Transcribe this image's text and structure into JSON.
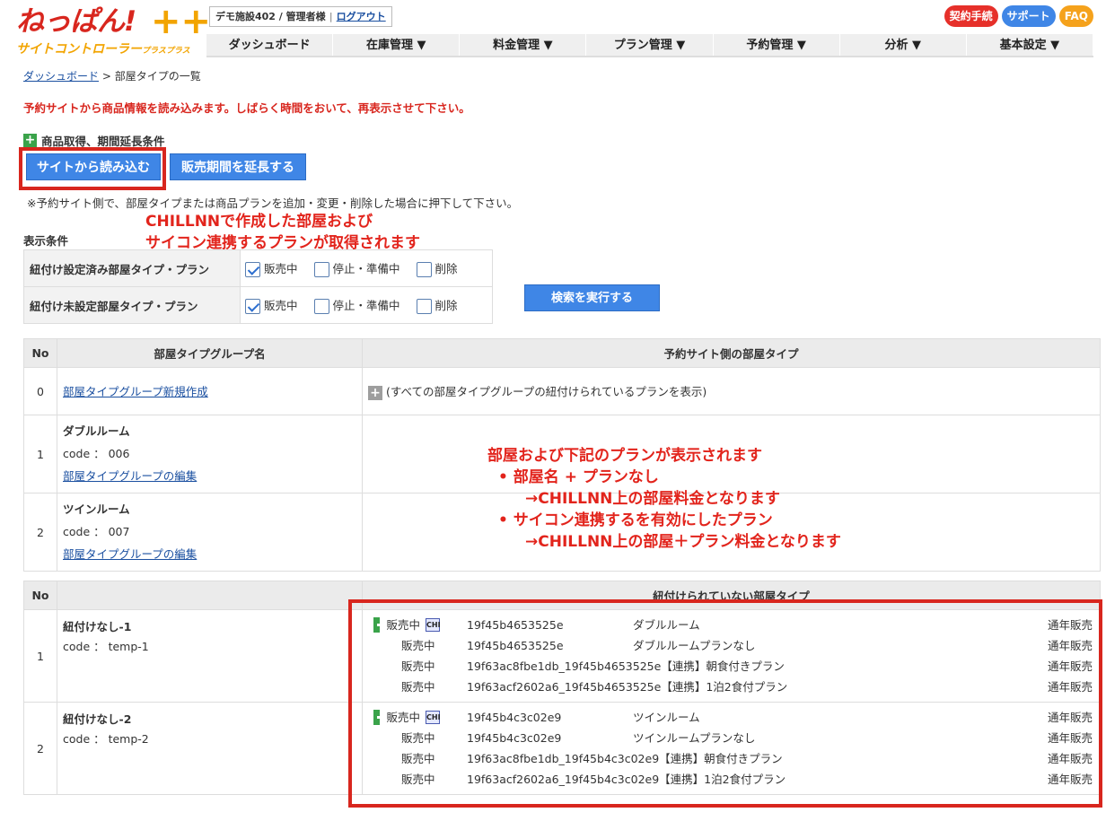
{
  "header": {
    "logo_main": "ねっぱん!",
    "logo_plus": "++",
    "logo_sub": "サイトコントローラー",
    "logo_sub_small": "プラスプラス",
    "facility": "デモ施設402 / 管理者様",
    "separator": "|",
    "logout": "ログアウト",
    "buttons": {
      "contract": "契約手続",
      "support": "サポート",
      "faq": "FAQ"
    },
    "nav": [
      "ダッシュボード",
      "在庫管理 ▼",
      "料金管理 ▼",
      "プラン管理 ▼",
      "予約管理 ▼",
      "分析 ▼",
      "基本設定 ▼"
    ]
  },
  "breadcrumb": {
    "home": "ダッシュボード",
    "sep": " > ",
    "current": "部屋タイプの一覧"
  },
  "warning": "予約サイトから商品情報を読み込みます。しばらく時間をおいて、再表示させて下さい。",
  "conditions": {
    "title": "商品取得、期間延長条件",
    "load_button": "サイトから読み込む",
    "extend_button": "販売期間を延長する",
    "note": "※予約サイト側で、部屋タイプまたは商品プランを追加・変更・削除した場合に押下して下さい。"
  },
  "annotations": {
    "a1_line1": "CHILLNNで作成した部屋および",
    "a1_line2": "サイコン連携するプランが取得されます",
    "a2_line1": "部屋および下記のプランが表示されます",
    "a2_line2": "•  部屋名 + プランなし",
    "a2_line3": "→CHILLNN上の部屋料金となります",
    "a2_line4": "•  サイコン連携するを有効にしたプラン",
    "a2_line5": "→CHILLNN上の部屋＋プラン料金となります"
  },
  "display": {
    "title": "表示条件",
    "rows": [
      {
        "label": "紐付け設定済み部屋タイプ・プラン",
        "opt1": "販売中",
        "opt2": "停止・準備中",
        "opt3": "削除"
      },
      {
        "label": "紐付け未設定部屋タイプ・プラン",
        "opt1": "販売中",
        "opt2": "停止・準備中",
        "opt3": "削除"
      }
    ],
    "search_button": "検索を実行する"
  },
  "groups": {
    "headers": {
      "no": "No",
      "name": "部屋タイプグループ名",
      "site": "予約サイト側の部屋タイプ"
    },
    "rows": [
      {
        "no": "0",
        "link": "部屋タイプグループ新規作成",
        "site": "(すべての部屋タイプグループの紐付けられているプランを表示)"
      },
      {
        "no": "1",
        "name": "ダブルルーム",
        "code": "code ：  006",
        "link": "部屋タイプグループの編集"
      },
      {
        "no": "2",
        "name": "ツインルーム",
        "code": "code ：  007",
        "link": "部屋タイプグループの編集"
      }
    ]
  },
  "unlinked": {
    "headers": {
      "no": "No",
      "name": "",
      "site": "紐付けられていない部屋タイプ"
    },
    "chi": "CHI",
    "rows": [
      {
        "no": "1",
        "name": "紐付けなし-1",
        "code": "code ：  temp-1",
        "plans": [
          {
            "status": "販売中",
            "id": "19f45b4653525e",
            "plan": "ダブルルーム",
            "period": "通年販売"
          },
          {
            "status": "販売中",
            "id": "19f45b4653525e",
            "plan": "ダブルルームプランなし",
            "period": "通年販売"
          },
          {
            "status": "販売中",
            "id": "19f63ac8fbe1db_19f45b4653525e",
            "plan": "【連携】朝食付きプラン",
            "period": "通年販売"
          },
          {
            "status": "販売中",
            "id": "19f63acf2602a6_19f45b4653525e",
            "plan": "【連携】1泊2食付プラン",
            "period": "通年販売"
          }
        ]
      },
      {
        "no": "2",
        "name": "紐付けなし-2",
        "code": "code ：  temp-2",
        "plans": [
          {
            "status": "販売中",
            "id": "19f45b4c3c02e9",
            "plan": "ツインルーム",
            "period": "通年販売"
          },
          {
            "status": "販売中",
            "id": "19f45b4c3c02e9",
            "plan": "ツインルームプランなし",
            "period": "通年販売"
          },
          {
            "status": "販売中",
            "id": "19f63ac8fbe1db_19f45b4c3c02e9",
            "plan": "【連携】朝食付きプラン",
            "period": "通年販売"
          },
          {
            "status": "販売中",
            "id": "19f63acf2602a6_19f45b4c3c02e9",
            "plan": "【連携】1泊2食付プラン",
            "period": "通年販売"
          }
        ]
      }
    ]
  }
}
